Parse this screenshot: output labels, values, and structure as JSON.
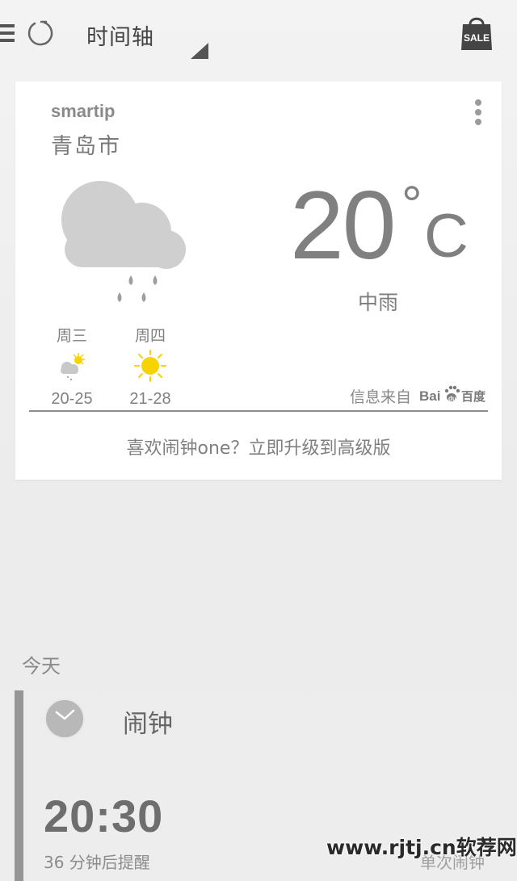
{
  "header": {
    "title": "时间轴"
  },
  "weather_card": {
    "app_name": "smartip",
    "city": "青岛市",
    "temperature": "20",
    "unit_degree": "°",
    "unit_c": "C",
    "condition": "中雨",
    "forecast": [
      {
        "day": "周三",
        "icon": "partly-cloudy-icon",
        "range": "20-25"
      },
      {
        "day": "周四",
        "icon": "sunny-icon",
        "range": "21-28"
      }
    ],
    "source_label": "信息来自",
    "upgrade_text": "喜欢闹钟one？立即升级到高级版"
  },
  "timeline": {
    "section_label": "今天",
    "item": {
      "title": "闹钟",
      "time": "20:30",
      "remind": "36 分钟后提醒",
      "type": "单次闹钟"
    }
  },
  "watermark": "www.rjtj.cn软荐网",
  "colors": {
    "sun": "#f5d400",
    "bar": "#969696",
    "icon_gray": "#b5b5b5"
  }
}
